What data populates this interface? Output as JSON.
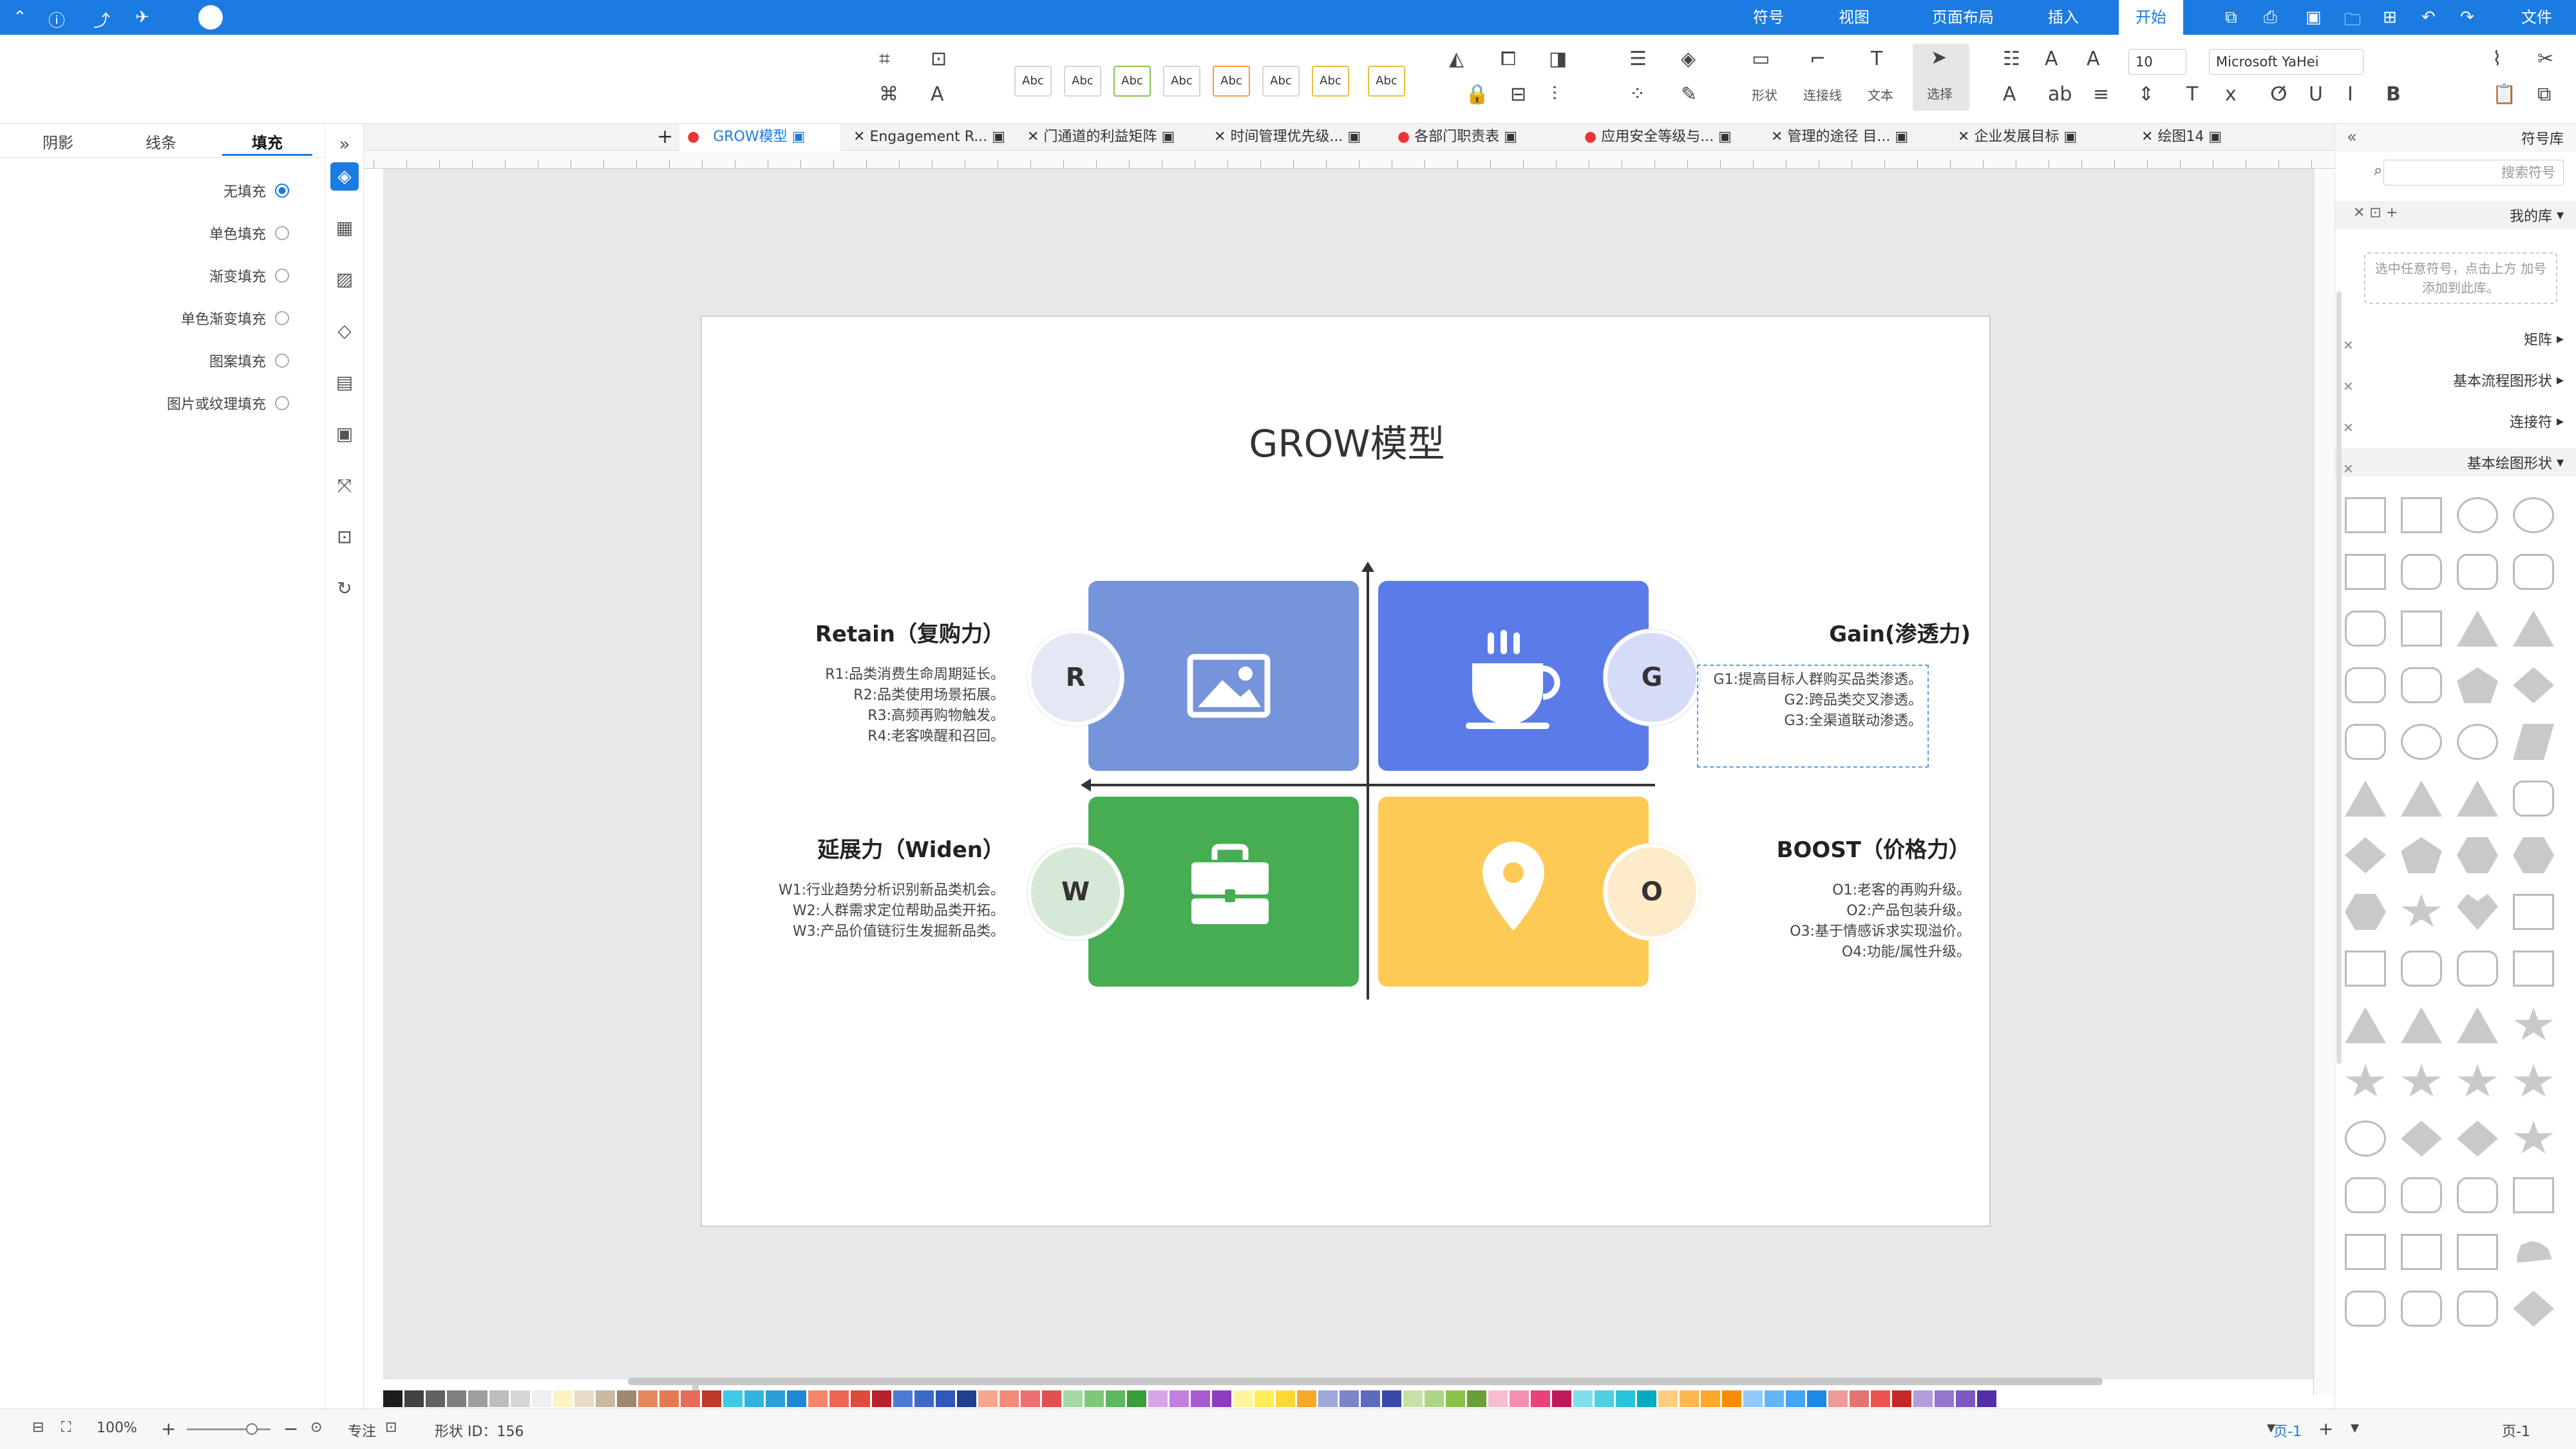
{
  "menubar": {
    "tabs": [
      "文件",
      "开始",
      "插入",
      "页面布局",
      "视图",
      "符号"
    ],
    "active": "开始"
  },
  "ribbon": {
    "font_name": "Microsoft YaHei",
    "font_size": "10",
    "select_label": "选择",
    "text_label": "文本",
    "connector_label": "连接线",
    "shape_label": "形状",
    "style_sample": "Abc"
  },
  "left_panel": {
    "tabs": [
      "填充",
      "线条",
      "阴影"
    ],
    "fill_options": [
      "无填充",
      "单色填充",
      "渐变填充",
      "单色渐变填充",
      "图案填充",
      "图片或纹理填充"
    ]
  },
  "doc_tabs": [
    "绘图14",
    "企业发展目标",
    "管理的途径 目...",
    "应用安全等级与...",
    "各部门职责表",
    "时间管理优先级...",
    "门通道的利益矩阵",
    "Engagement R...",
    "GROW模型"
  ],
  "active_doc": "GROW模型",
  "diagram": {
    "title": "GROW模型",
    "quadrants": [
      {
        "letter": "G",
        "heading": "Gain(渗透力)",
        "lines": [
          "G1:提高目标人群购买品类渗透。",
          "G2:跨品类交叉渗透。",
          "G3:全渠道联动渗透。"
        ],
        "color": "#5b7ce8",
        "bubble": "#d5dcf8",
        "icon": "coffee-cup-icon"
      },
      {
        "letter": "R",
        "heading": "Retain（复购力）",
        "lines": [
          "R1:品类消费生命周期延长。",
          "R2:品类使用场景拓展。",
          "R3:高频再购物触发。",
          "R4:老客唤醒和召回。"
        ],
        "color": "#7694d9",
        "bubble": "#e3e8f4",
        "icon": "image-icon"
      },
      {
        "letter": "O",
        "heading": "BOOST（价格力）",
        "lines": [
          "O1:老客的再购升级。",
          "O2:产品包装升级。",
          "O3:基于情感诉求实现溢价。",
          "O4:功能/属性升级。"
        ],
        "color": "#fdca56",
        "bubble": "#fdebc9",
        "icon": "location-pin-icon"
      },
      {
        "letter": "W",
        "heading": "延展力（Widen）",
        "lines": [
          "W1:行业趋势分析识别新品类机会。",
          "W2:人群需求定位帮助品类开拓。",
          "W3:产品价值链衍生发掘新品类。"
        ],
        "color": "#46ad52",
        "bubble": "#d6e8d6",
        "icon": "briefcase-icon"
      }
    ]
  },
  "right_panel": {
    "title": "符号库",
    "search_placeholder": "搜索符号",
    "my_library": "我的库",
    "hint": "选中任意符号，点击上方 加号添加到此库。",
    "sections": [
      "矩阵",
      "基本流程图形状",
      "连接符",
      "基本绘图形状"
    ]
  },
  "status": {
    "page": "页-1",
    "shape_id": "形状 ID：156",
    "focus": "专注",
    "zoom": "100%"
  },
  "palette": [
    "#1d1d1d",
    "#424242",
    "#616161",
    "#808080",
    "#9e9e9e",
    "#bdbdbd",
    "#d6d6d6",
    "#efefef",
    "#fff3c4",
    "#e6dcc8",
    "#c9b9a0",
    "#a08870",
    "#e8865c",
    "#e57a4e",
    "#ea6a5a",
    "#c0392b",
    "#3dc9e8",
    "#2fb4e0",
    "#2aa0d8",
    "#1e88d6",
    "#f7856a",
    "#f06450",
    "#e04a3a",
    "#b8202a",
    "#4c7bd6",
    "#3d6ac8",
    "#2f58b8",
    "#1f3f90",
    "#f9a58e",
    "#f58a7a",
    "#ee7070",
    "#e25050",
    "#a3d9a0",
    "#7ec87a",
    "#5cb85c",
    "#3a9e3a",
    "#d9a3e8",
    "#c47ee0",
    "#a85cd0",
    "#8e3cc0",
    "#fff59d",
    "#ffee58",
    "#fdd835",
    "#f9a825",
    "#9fa8da",
    "#7986cb",
    "#5c6bc0",
    "#3949ab",
    "#c5e1a5",
    "#aed581",
    "#8bc34a",
    "#689f38",
    "#f8bbd0",
    "#f48fb1",
    "#ec407a",
    "#c2185b",
    "#80deea",
    "#4dd0e1",
    "#26c6da",
    "#00acc1",
    "#ffcc80",
    "#ffb74d",
    "#ffa726",
    "#fb8c00",
    "#90caf9",
    "#64b5f6",
    "#42a5f5",
    "#1e88e5",
    "#ef9a9a",
    "#e57373",
    "#ef5350",
    "#c62828",
    "#b39ddb",
    "#9575cd",
    "#7e57c2",
    "#512da8"
  ]
}
